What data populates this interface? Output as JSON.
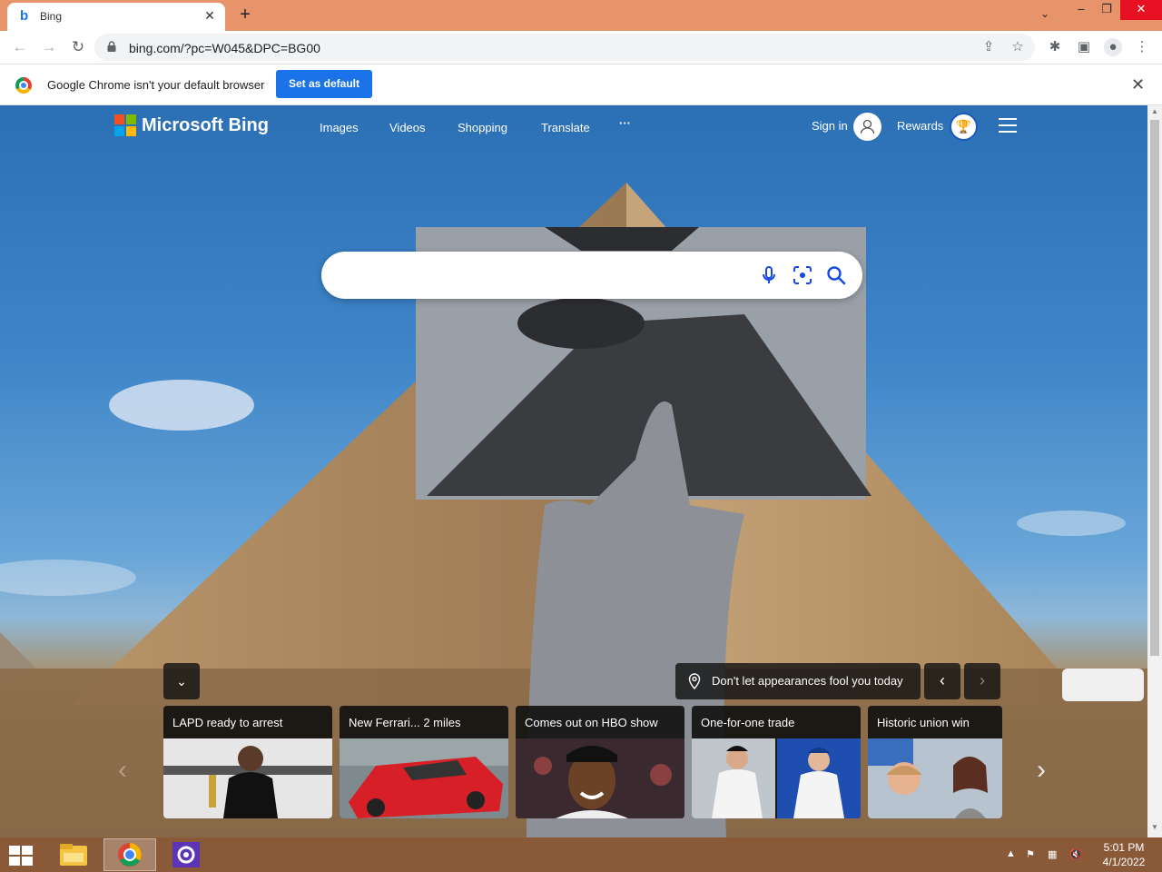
{
  "browser": {
    "tab_title": "Bing",
    "url": "bing.com/?pc=W045&DPC=BG00",
    "infobar_message": "Google Chrome isn't your default browser",
    "set_default_label": "Set as default"
  },
  "bing": {
    "brand": "Microsoft Bing",
    "nav": [
      "Images",
      "Videos",
      "Shopping",
      "Translate",
      "···"
    ],
    "sign_in_label": "Sign in",
    "rewards_label": "Rewards",
    "search_placeholder": ""
  },
  "image_caption": "Don't let appearances fool you today",
  "news_cards": [
    {
      "title": "LAPD ready to arrest"
    },
    {
      "title": "New Ferrari... 2 miles"
    },
    {
      "title": "Comes out on HBO show"
    },
    {
      "title": "One-for-one trade"
    },
    {
      "title": "Historic union win"
    }
  ],
  "taskbar": {
    "time": "5:01 PM",
    "date": "4/1/2022"
  },
  "colors": {
    "accent_blue": "#1a73e8",
    "titlebar": "#E8946A",
    "taskbar": "#8a5a38",
    "close_red": "#e81123"
  }
}
